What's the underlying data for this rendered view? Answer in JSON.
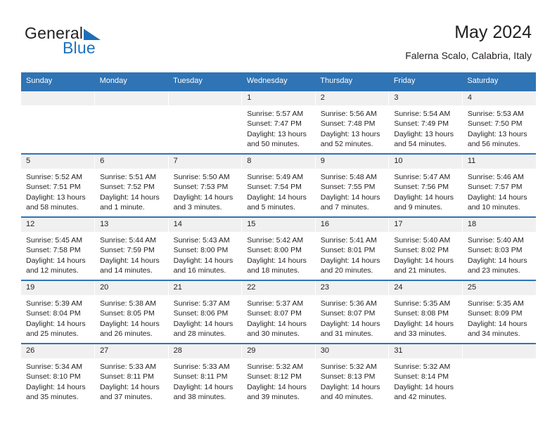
{
  "brand": {
    "name_part1": "General",
    "name_part2": "Blue",
    "triangle_icon": "triangle-logo-icon",
    "accent_color": "#1d6fb8"
  },
  "header": {
    "title": "May 2024",
    "subtitle": "Falerna Scalo, Calabria, Italy"
  },
  "colors": {
    "header_blue": "#2f74b5",
    "daynum_band": "#f0f0f0",
    "text": "#231f20"
  },
  "calendar": {
    "weekday_headers": [
      "Sunday",
      "Monday",
      "Tuesday",
      "Wednesday",
      "Thursday",
      "Friday",
      "Saturday"
    ],
    "weeks": [
      [
        {
          "day": "",
          "empty": true,
          "sunrise": "",
          "sunset": "",
          "daylight_line1": "",
          "daylight_line2": ""
        },
        {
          "day": "",
          "empty": true,
          "sunrise": "",
          "sunset": "",
          "daylight_line1": "",
          "daylight_line2": ""
        },
        {
          "day": "",
          "empty": true,
          "sunrise": "",
          "sunset": "",
          "daylight_line1": "",
          "daylight_line2": ""
        },
        {
          "day": "1",
          "empty": false,
          "sunrise": "Sunrise: 5:57 AM",
          "sunset": "Sunset: 7:47 PM",
          "daylight_line1": "Daylight: 13 hours",
          "daylight_line2": "and 50 minutes."
        },
        {
          "day": "2",
          "empty": false,
          "sunrise": "Sunrise: 5:56 AM",
          "sunset": "Sunset: 7:48 PM",
          "daylight_line1": "Daylight: 13 hours",
          "daylight_line2": "and 52 minutes."
        },
        {
          "day": "3",
          "empty": false,
          "sunrise": "Sunrise: 5:54 AM",
          "sunset": "Sunset: 7:49 PM",
          "daylight_line1": "Daylight: 13 hours",
          "daylight_line2": "and 54 minutes."
        },
        {
          "day": "4",
          "empty": false,
          "sunrise": "Sunrise: 5:53 AM",
          "sunset": "Sunset: 7:50 PM",
          "daylight_line1": "Daylight: 13 hours",
          "daylight_line2": "and 56 minutes."
        }
      ],
      [
        {
          "day": "5",
          "empty": false,
          "sunrise": "Sunrise: 5:52 AM",
          "sunset": "Sunset: 7:51 PM",
          "daylight_line1": "Daylight: 13 hours",
          "daylight_line2": "and 58 minutes."
        },
        {
          "day": "6",
          "empty": false,
          "sunrise": "Sunrise: 5:51 AM",
          "sunset": "Sunset: 7:52 PM",
          "daylight_line1": "Daylight: 14 hours",
          "daylight_line2": "and 1 minute."
        },
        {
          "day": "7",
          "empty": false,
          "sunrise": "Sunrise: 5:50 AM",
          "sunset": "Sunset: 7:53 PM",
          "daylight_line1": "Daylight: 14 hours",
          "daylight_line2": "and 3 minutes."
        },
        {
          "day": "8",
          "empty": false,
          "sunrise": "Sunrise: 5:49 AM",
          "sunset": "Sunset: 7:54 PM",
          "daylight_line1": "Daylight: 14 hours",
          "daylight_line2": "and 5 minutes."
        },
        {
          "day": "9",
          "empty": false,
          "sunrise": "Sunrise: 5:48 AM",
          "sunset": "Sunset: 7:55 PM",
          "daylight_line1": "Daylight: 14 hours",
          "daylight_line2": "and 7 minutes."
        },
        {
          "day": "10",
          "empty": false,
          "sunrise": "Sunrise: 5:47 AM",
          "sunset": "Sunset: 7:56 PM",
          "daylight_line1": "Daylight: 14 hours",
          "daylight_line2": "and 9 minutes."
        },
        {
          "day": "11",
          "empty": false,
          "sunrise": "Sunrise: 5:46 AM",
          "sunset": "Sunset: 7:57 PM",
          "daylight_line1": "Daylight: 14 hours",
          "daylight_line2": "and 10 minutes."
        }
      ],
      [
        {
          "day": "12",
          "empty": false,
          "sunrise": "Sunrise: 5:45 AM",
          "sunset": "Sunset: 7:58 PM",
          "daylight_line1": "Daylight: 14 hours",
          "daylight_line2": "and 12 minutes."
        },
        {
          "day": "13",
          "empty": false,
          "sunrise": "Sunrise: 5:44 AM",
          "sunset": "Sunset: 7:59 PM",
          "daylight_line1": "Daylight: 14 hours",
          "daylight_line2": "and 14 minutes."
        },
        {
          "day": "14",
          "empty": false,
          "sunrise": "Sunrise: 5:43 AM",
          "sunset": "Sunset: 8:00 PM",
          "daylight_line1": "Daylight: 14 hours",
          "daylight_line2": "and 16 minutes."
        },
        {
          "day": "15",
          "empty": false,
          "sunrise": "Sunrise: 5:42 AM",
          "sunset": "Sunset: 8:00 PM",
          "daylight_line1": "Daylight: 14 hours",
          "daylight_line2": "and 18 minutes."
        },
        {
          "day": "16",
          "empty": false,
          "sunrise": "Sunrise: 5:41 AM",
          "sunset": "Sunset: 8:01 PM",
          "daylight_line1": "Daylight: 14 hours",
          "daylight_line2": "and 20 minutes."
        },
        {
          "day": "17",
          "empty": false,
          "sunrise": "Sunrise: 5:40 AM",
          "sunset": "Sunset: 8:02 PM",
          "daylight_line1": "Daylight: 14 hours",
          "daylight_line2": "and 21 minutes."
        },
        {
          "day": "18",
          "empty": false,
          "sunrise": "Sunrise: 5:40 AM",
          "sunset": "Sunset: 8:03 PM",
          "daylight_line1": "Daylight: 14 hours",
          "daylight_line2": "and 23 minutes."
        }
      ],
      [
        {
          "day": "19",
          "empty": false,
          "sunrise": "Sunrise: 5:39 AM",
          "sunset": "Sunset: 8:04 PM",
          "daylight_line1": "Daylight: 14 hours",
          "daylight_line2": "and 25 minutes."
        },
        {
          "day": "20",
          "empty": false,
          "sunrise": "Sunrise: 5:38 AM",
          "sunset": "Sunset: 8:05 PM",
          "daylight_line1": "Daylight: 14 hours",
          "daylight_line2": "and 26 minutes."
        },
        {
          "day": "21",
          "empty": false,
          "sunrise": "Sunrise: 5:37 AM",
          "sunset": "Sunset: 8:06 PM",
          "daylight_line1": "Daylight: 14 hours",
          "daylight_line2": "and 28 minutes."
        },
        {
          "day": "22",
          "empty": false,
          "sunrise": "Sunrise: 5:37 AM",
          "sunset": "Sunset: 8:07 PM",
          "daylight_line1": "Daylight: 14 hours",
          "daylight_line2": "and 30 minutes."
        },
        {
          "day": "23",
          "empty": false,
          "sunrise": "Sunrise: 5:36 AM",
          "sunset": "Sunset: 8:07 PM",
          "daylight_line1": "Daylight: 14 hours",
          "daylight_line2": "and 31 minutes."
        },
        {
          "day": "24",
          "empty": false,
          "sunrise": "Sunrise: 5:35 AM",
          "sunset": "Sunset: 8:08 PM",
          "daylight_line1": "Daylight: 14 hours",
          "daylight_line2": "and 33 minutes."
        },
        {
          "day": "25",
          "empty": false,
          "sunrise": "Sunrise: 5:35 AM",
          "sunset": "Sunset: 8:09 PM",
          "daylight_line1": "Daylight: 14 hours",
          "daylight_line2": "and 34 minutes."
        }
      ],
      [
        {
          "day": "26",
          "empty": false,
          "sunrise": "Sunrise: 5:34 AM",
          "sunset": "Sunset: 8:10 PM",
          "daylight_line1": "Daylight: 14 hours",
          "daylight_line2": "and 35 minutes."
        },
        {
          "day": "27",
          "empty": false,
          "sunrise": "Sunrise: 5:33 AM",
          "sunset": "Sunset: 8:11 PM",
          "daylight_line1": "Daylight: 14 hours",
          "daylight_line2": "and 37 minutes."
        },
        {
          "day": "28",
          "empty": false,
          "sunrise": "Sunrise: 5:33 AM",
          "sunset": "Sunset: 8:11 PM",
          "daylight_line1": "Daylight: 14 hours",
          "daylight_line2": "and 38 minutes."
        },
        {
          "day": "29",
          "empty": false,
          "sunrise": "Sunrise: 5:32 AM",
          "sunset": "Sunset: 8:12 PM",
          "daylight_line1": "Daylight: 14 hours",
          "daylight_line2": "and 39 minutes."
        },
        {
          "day": "30",
          "empty": false,
          "sunrise": "Sunrise: 5:32 AM",
          "sunset": "Sunset: 8:13 PM",
          "daylight_line1": "Daylight: 14 hours",
          "daylight_line2": "and 40 minutes."
        },
        {
          "day": "31",
          "empty": false,
          "sunrise": "Sunrise: 5:32 AM",
          "sunset": "Sunset: 8:14 PM",
          "daylight_line1": "Daylight: 14 hours",
          "daylight_line2": "and 42 minutes."
        },
        {
          "day": "",
          "empty": true,
          "sunrise": "",
          "sunset": "",
          "daylight_line1": "",
          "daylight_line2": ""
        }
      ]
    ]
  }
}
